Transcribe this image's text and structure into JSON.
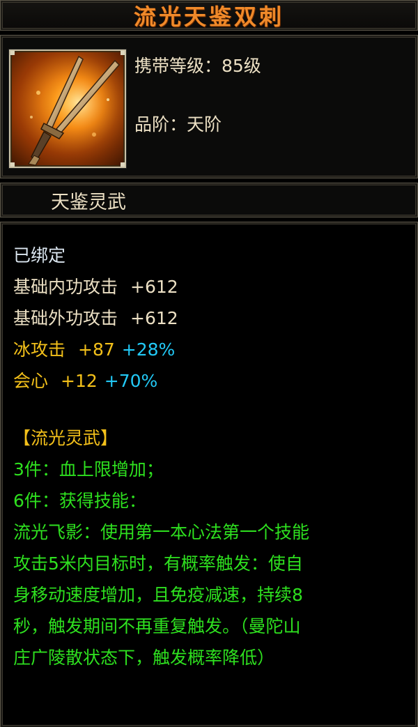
{
  "item": {
    "name": "流光天鉴双刺",
    "level_label": "携带等级：85级",
    "grade_label": "品阶：天阶",
    "category": "天鉴灵武"
  },
  "stats": {
    "bound": "已绑定",
    "inner_attack_label": "基础内功攻击",
    "inner_attack_value": "+612",
    "outer_attack_label": "基础外功攻击",
    "outer_attack_value": "+612",
    "ice_attack_label": "冰攻击",
    "ice_attack_value": "+87",
    "ice_attack_bonus": "+28%",
    "crit_label": "会心",
    "crit_value": "+12",
    "crit_bonus": "+70%"
  },
  "set": {
    "title": "【流光灵武】",
    "piece3": "3件：血上限增加；",
    "piece6": "6件：获得技能：",
    "desc_lines": [
      "流光飞影：使用第一本心法第一个技能",
      "攻击5米内目标时，有概率触发：使自",
      "身移动速度增加，且免疫减速，持续8",
      "秒，触发期间不再重复触发。（曼陀山",
      "庄广陵散状态下，触发概率降低）"
    ]
  },
  "colors": {
    "title": "#f08a2a",
    "normal": "#ece0c4",
    "bound": "#dbe6f0",
    "yellow": "#f3c01a",
    "cyan": "#22c9f6",
    "green": "#2ee01f"
  },
  "icon": "dual-dagger-weapon-icon"
}
